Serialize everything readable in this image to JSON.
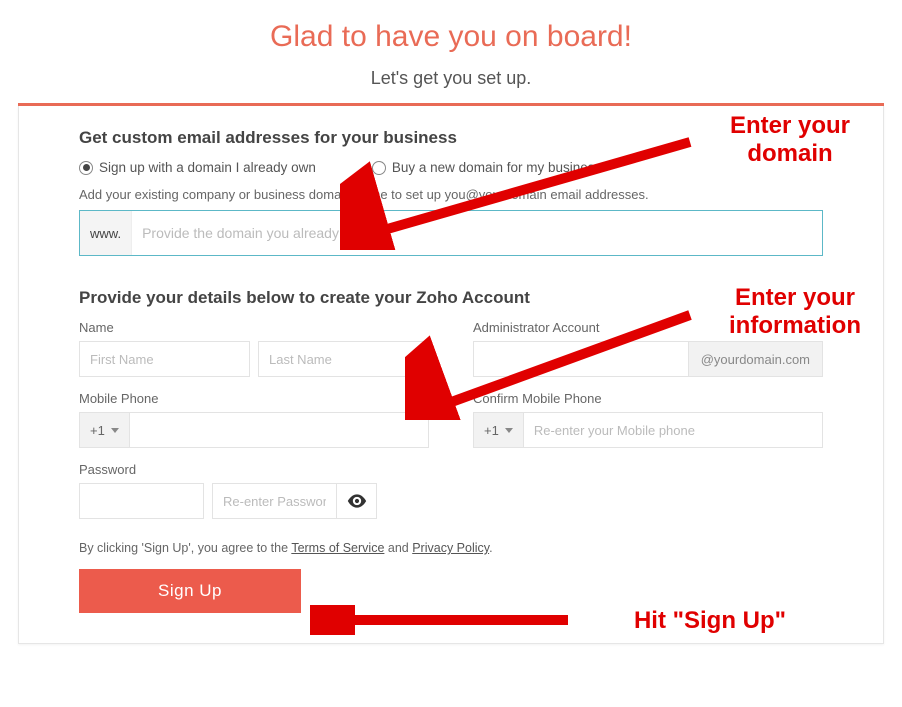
{
  "header": {
    "title": "Glad to have you on board!",
    "subtitle": "Let's get you set up."
  },
  "domain_section": {
    "heading": "Get custom email addresses for your business",
    "option_own": "Sign up with a domain I already own",
    "option_buy": "Buy a new domain for my business",
    "helper": "Add your existing company or business domain name to set up you@yourdomain email addresses.",
    "prefix": "www.",
    "placeholder": "Provide the domain you already own"
  },
  "details_section": {
    "heading": "Provide your details below to create your Zoho Account",
    "name_label": "Name",
    "first_name_placeholder": "First Name",
    "last_name_placeholder": "Last Name",
    "admin_label": "Administrator Account",
    "admin_suffix": "@yourdomain.com",
    "mobile_label": "Mobile Phone",
    "confirm_mobile_label": "Confirm Mobile Phone",
    "phone_code": "+1",
    "confirm_mobile_placeholder": "Re-enter your Mobile phone",
    "password_label": "Password",
    "password2_placeholder": "Re-enter Password"
  },
  "agree": {
    "prefix": "By clicking 'Sign Up', you agree to the ",
    "tos": "Terms of Service",
    "mid": " and ",
    "privacy": "Privacy Policy",
    "suffix": "."
  },
  "signup_button": "Sign Up",
  "annotations": {
    "enter_domain": "Enter your\ndomain",
    "enter_info": "Enter your\ninformation",
    "hit_signup": "Hit \"Sign Up\""
  },
  "colors": {
    "accent": "#e96b56",
    "annotation": "#e00000"
  }
}
